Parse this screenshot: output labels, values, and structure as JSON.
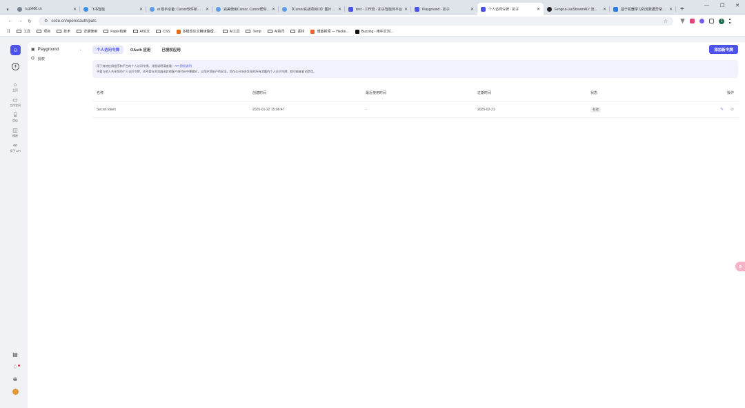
{
  "browser": {
    "tabs": [
      {
        "title": "n.gb688.cn",
        "active": false
      },
      {
        "title": "飞书智能",
        "active": false
      },
      {
        "title": "ai 助手必备: Cursor软件新手...",
        "active": false
      },
      {
        "title": "完美使用Cursor, Cursor帮你...",
        "active": false
      },
      {
        "title": "【Cursor实战项目01】图片上...",
        "active": false
      },
      {
        "title": "test - 工作流 - 扣子智能体平台",
        "active": false
      },
      {
        "title": "Playground - 扣子",
        "active": false
      },
      {
        "title": "个人访问令牌 - 扣子",
        "active": true
      },
      {
        "title": "Fengrui-Liu/StreamAD: 流...",
        "active": false
      },
      {
        "title": "基于机器学习的流数据异常检测...",
        "active": false
      }
    ],
    "url": "coze.cn/open/oauth/pats",
    "profile_initial": "1",
    "bookmarks": [
      "工具",
      "项目",
      "技术",
      "近期使用",
      "Paper检索",
      "AI论文",
      "CSS",
      "多模态论文精读整理...",
      "AI工具",
      "Temp",
      "AI资讯",
      "素材",
      "博客新闻 — Hacke...",
      "Buzzing - 用中文浏..."
    ]
  },
  "rail": {
    "items": [
      {
        "label": "主页",
        "icon": "⌂"
      },
      {
        "label": "工作空间",
        "icon": "▭"
      },
      {
        "label": "商店",
        "icon": "⌸"
      },
      {
        "label": "模板",
        "icon": "◫"
      },
      {
        "label": "扣子 API",
        "icon": "∞"
      }
    ]
  },
  "leftnav": {
    "header": "Playground",
    "item": "授权"
  },
  "main": {
    "tabs": [
      {
        "label": "个人访问令牌",
        "active": true
      },
      {
        "label": "OAuth 应用",
        "active": false
      },
      {
        "label": "已授权应用",
        "active": false
      }
    ],
    "add_button": "添加新令牌",
    "notice_line1": "用于其他应用程序和平台的个人访问令牌。详细说明请查看：",
    "notice_link": "API 授权说明",
    "notice_line2": "不要与他人共享您的个人访问令牌，也不要在浏览器或其他客户端代码中暴露它，以保护您账户的安全。您在公开场合发现的所有泄露的个人访问令牌，都可能被自动禁用。",
    "table": {
      "headers": [
        "名称",
        "创建时间",
        "最近使用时间",
        "过期时间",
        "状态",
        "操作"
      ],
      "rows": [
        {
          "name": "Secret token",
          "created": "2025-01-22 15:06:47",
          "last_used": "-",
          "expires": "2025-02-21",
          "status": "有效"
        }
      ]
    }
  },
  "colors": {
    "accent": "#4d53e8",
    "notice_bg": "#f1f2fd"
  }
}
